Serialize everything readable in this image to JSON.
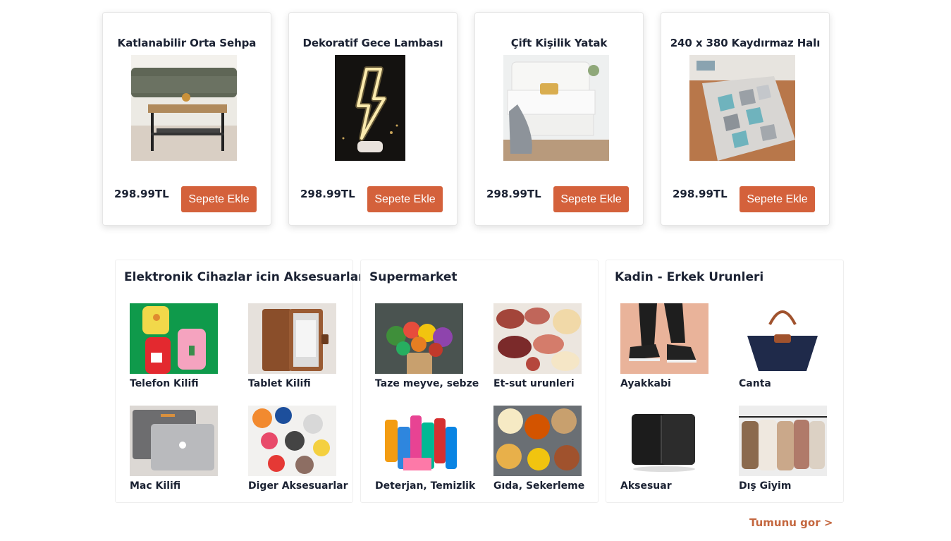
{
  "products": [
    {
      "title": "Katlanabilir Orta Sehpa",
      "price": "298.99TL",
      "button": "Sepete Ekle",
      "image": "coffee-table-photo"
    },
    {
      "title": "Dekoratif Gece Lambası",
      "price": "298.99TL",
      "button": "Sepete Ekle",
      "image": "neon-lamp-photo"
    },
    {
      "title": "Çift Kişilik Yatak",
      "price": "298.99TL",
      "button": "Sepete Ekle",
      "image": "bed-photo"
    },
    {
      "title": "240 x 380 Kaydırmaz Halı",
      "price": "298.99TL",
      "button": "Sepete Ekle",
      "image": "rug-photo"
    }
  ],
  "categories": [
    {
      "title": "Elektronik Cihazlar icin Aksesuarlar",
      "items": [
        {
          "label": "Telefon Kilifi",
          "image": "phone-case-photo"
        },
        {
          "label": "Tablet Kilifi",
          "image": "tablet-case-photo"
        },
        {
          "label": "Mac Kilifi",
          "image": "laptop-sleeve-photo"
        },
        {
          "label": "Diger Aksesuarlar",
          "image": "popsocket-photo"
        }
      ]
    },
    {
      "title": "Supermarket",
      "items": [
        {
          "label": "Taze meyve, sebze",
          "image": "vegetables-photo"
        },
        {
          "label": "Et-sut urunleri",
          "image": "deli-meat-photo"
        },
        {
          "label": "Deterjan, Temizlik",
          "image": "detergent-photo"
        },
        {
          "label": "Gıda, Sekerleme",
          "image": "snacks-photo"
        }
      ]
    },
    {
      "title": "Kadin - Erkek Urunleri",
      "items": [
        {
          "label": "Ayakkabi",
          "image": "sneakers-photo"
        },
        {
          "label": "Canta",
          "image": "handbag-photo"
        },
        {
          "label": "Aksesuar",
          "image": "wallet-photo"
        },
        {
          "label": "Dış Giyim",
          "image": "coats-photo"
        }
      ]
    }
  ],
  "see_all": "Tumunu gor >",
  "colors": {
    "accent": "#d4613b",
    "link": "#c4673f",
    "text": "#1b2233"
  }
}
